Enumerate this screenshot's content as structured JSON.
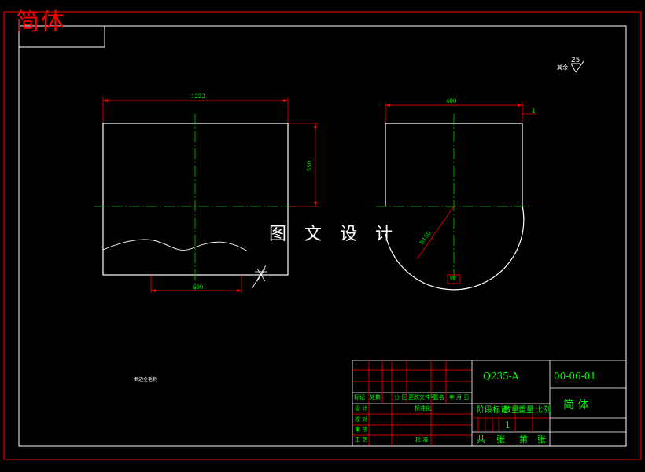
{
  "corner_title": "简体",
  "watermark": "图 文 设 计",
  "roughness": {
    "value": "25",
    "label": "其余"
  },
  "left_view": {
    "width_dim": "1222",
    "height_dim": "550",
    "bottom_dim": "600",
    "note": "倒边全毛刺"
  },
  "right_view": {
    "width_dim": "400",
    "thickness_dim": "4",
    "radius_dim": "R150",
    "bottom_label": "90"
  },
  "title_block": {
    "material": "Q235-A",
    "drawing_no": "00-06-01",
    "part_name": "简 体",
    "header_row": [
      "标记",
      "处数",
      "分 区",
      "更改文件号",
      "签名",
      "年 月 日"
    ],
    "row_labels": [
      "设 计",
      "校 对",
      "审 核",
      "工 艺"
    ],
    "std": "标准化",
    "approve": "批 准",
    "stage_labels": [
      "阶段标记",
      "数量",
      "重量",
      "比例"
    ],
    "ratio": "1",
    "sheets": [
      "共",
      "张",
      "第",
      "张"
    ]
  },
  "colors": {
    "frame": "#ffffff",
    "dim": "#ff0000",
    "text": "#00ff00",
    "title": "#ff0000",
    "center": "#00cc00"
  }
}
